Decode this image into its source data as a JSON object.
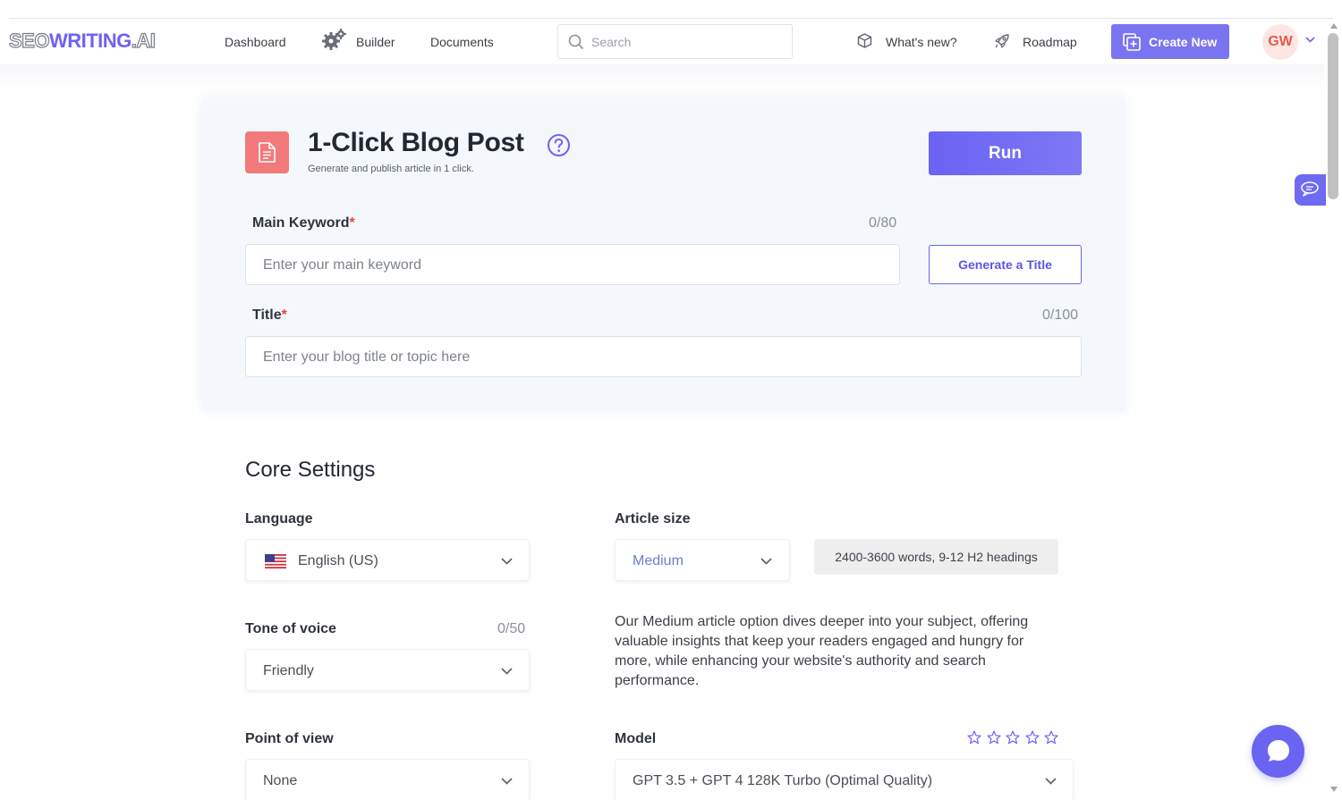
{
  "header": {
    "logo": {
      "part1": "SEO",
      "part2": "WRITING",
      "part3": ".AI"
    },
    "nav": {
      "dashboard": "Dashboard",
      "builder": "Builder",
      "documents": "Documents"
    },
    "search_placeholder": "Search",
    "whats_new": "What's new?",
    "roadmap": "Roadmap",
    "create_new": "Create New",
    "avatar_initials": "GW"
  },
  "card": {
    "title": "1-Click Blog Post",
    "subtitle": "Generate and publish article in 1 click.",
    "run_label": "Run",
    "main_keyword": {
      "label": "Main Keyword",
      "required_mark": "*",
      "counter": "0/80",
      "placeholder": "Enter your main keyword",
      "value": ""
    },
    "generate_title_label": "Generate a Title",
    "title_field": {
      "label": "Title",
      "required_mark": "*",
      "counter": "0/100",
      "placeholder": "Enter your blog title or topic here",
      "value": ""
    }
  },
  "core_settings": {
    "heading": "Core Settings",
    "language": {
      "label": "Language",
      "value": "English (US)",
      "flag_icon": "us-flag-icon"
    },
    "article_size": {
      "label": "Article size",
      "value": "Medium",
      "info": "2400-3600 words, 9-12 H2 headings",
      "description": "Our Medium article option dives deeper into your subject, offering valuable insights that keep your readers engaged and hungry for more, while enhancing your website's authority and search performance."
    },
    "tone_of_voice": {
      "label": "Tone of voice",
      "counter": "0/50",
      "value": "Friendly"
    },
    "point_of_view": {
      "label": "Point of view",
      "value": "None"
    },
    "model": {
      "label": "Model",
      "value": "GPT 3.5 + GPT 4 128K Turbo (Optimal Quality)",
      "rating": 0,
      "rating_max": 5
    }
  },
  "colors": {
    "accent": "#6b64f3",
    "doc_icon_bg": "#f27a7a",
    "required": "#e5483b",
    "avatar_bg": "#fde6e3"
  }
}
